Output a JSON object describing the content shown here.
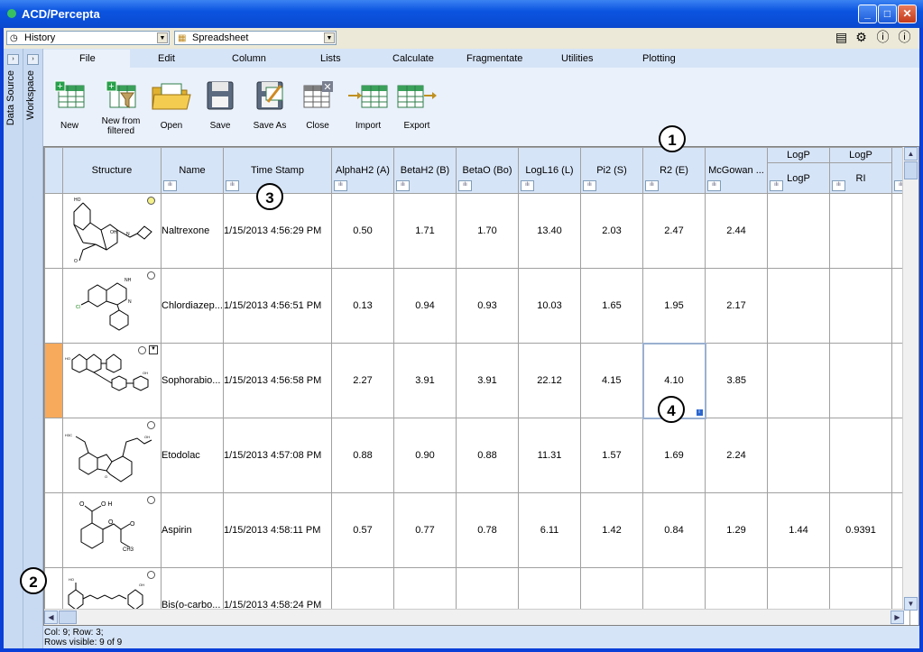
{
  "window": {
    "title": "ACD/Percepta"
  },
  "toolbar": {
    "history_combo": "History",
    "view_combo": "Spreadsheet",
    "right_icons": [
      "calculator-icon",
      "gear-icon",
      "help-icon",
      "info-icon"
    ]
  },
  "sidebars": {
    "data_source": "Data Source",
    "workspace": "Workspace"
  },
  "menu_tabs": [
    "File",
    "Edit",
    "Column",
    "Lists",
    "Calculate",
    "Fragmentate",
    "Utilities",
    "Plotting"
  ],
  "ribbon": {
    "new": "New",
    "new_filtered_1": "New from",
    "new_filtered_2": "filtered",
    "open": "Open",
    "save": "Save",
    "save_as": "Save As",
    "close": "Close",
    "import": "Import",
    "export": "Export"
  },
  "grid": {
    "group_header_logp": "LogP",
    "columns": [
      "Structure",
      "Name",
      "Time Stamp",
      "AlphaH2 (A)",
      "BetaH2 (B)",
      "BetaO (Bo)",
      "LogL16 (L)",
      "Pi2 (S)",
      "R2 (E)",
      "McGowan ...",
      "LogP",
      "RI"
    ],
    "rows": [
      {
        "name": "Naltrexone",
        "time": "1/15/2013 4:56:29 PM",
        "a": "0.50",
        "b": "1.71",
        "bo": "1.70",
        "l": "13.40",
        "s": "2.03",
        "e": "2.47",
        "mg": "2.44",
        "logp": "",
        "ri": ""
      },
      {
        "name": "Chlordiazep...",
        "time": "1/15/2013 4:56:51 PM",
        "a": "0.13",
        "b": "0.94",
        "bo": "0.93",
        "l": "10.03",
        "s": "1.65",
        "e": "1.95",
        "mg": "2.17",
        "logp": "",
        "ri": ""
      },
      {
        "name": "Sophorabio...",
        "time": "1/15/2013 4:56:58 PM",
        "a": "2.27",
        "b": "3.91",
        "bo": "3.91",
        "l": "22.12",
        "s": "4.15",
        "e": "4.10",
        "mg": "3.85",
        "logp": "",
        "ri": ""
      },
      {
        "name": "Etodolac",
        "time": "1/15/2013 4:57:08 PM",
        "a": "0.88",
        "b": "0.90",
        "bo": "0.88",
        "l": "11.31",
        "s": "1.57",
        "e": "1.69",
        "mg": "2.24",
        "logp": "",
        "ri": ""
      },
      {
        "name": "Aspirin",
        "time": "1/15/2013 4:58:11 PM",
        "a": "0.57",
        "b": "0.77",
        "bo": "0.78",
        "l": "6.11",
        "s": "1.42",
        "e": "0.84",
        "mg": "1.29",
        "logp": "1.44",
        "ri": "0.9391"
      },
      {
        "name": "Bis(o-carbo...",
        "time": "1/15/2013 4:58:24 PM",
        "a": "",
        "b": "",
        "bo": "",
        "l": "",
        "s": "",
        "e": "",
        "mg": "",
        "logp": "",
        "ri": ""
      }
    ]
  },
  "callouts": [
    "1",
    "2",
    "3",
    "4"
  ],
  "status": {
    "line1": "Col: 9; Row: 3;",
    "line2": "Rows visible: 9 of 9"
  },
  "colors": {
    "title_blue": "#0a49cf",
    "selected_header": "#fbb360",
    "panel": "#d6e4f7"
  }
}
